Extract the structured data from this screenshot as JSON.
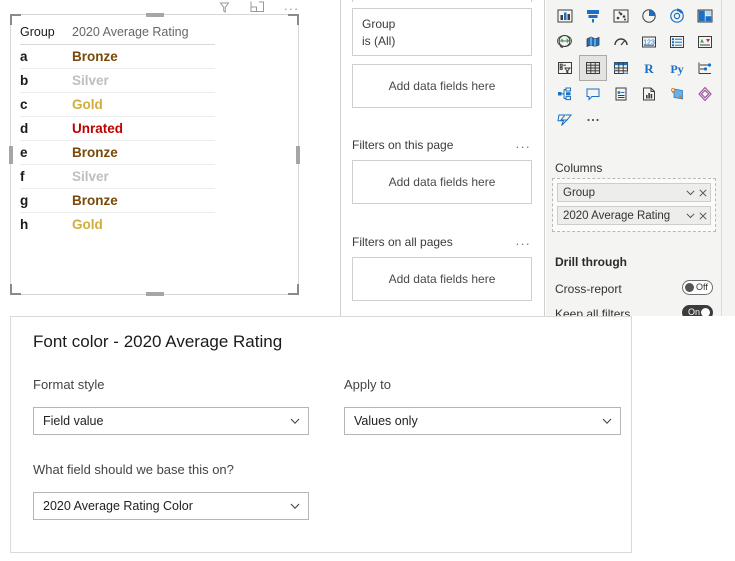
{
  "visual_header": {
    "filter_icon": "filter-icon",
    "focus_icon": "focus-mode-icon",
    "more_label": "..."
  },
  "table_visual": {
    "columns": [
      "Group",
      "2020 Average Rating"
    ],
    "rows": [
      {
        "group": "a",
        "rating": "Bronze",
        "color": "#7B4A0A"
      },
      {
        "group": "b",
        "rating": "Silver",
        "color": "#BFBFBF"
      },
      {
        "group": "c",
        "rating": "Gold",
        "color": "#CFAE3B"
      },
      {
        "group": "d",
        "rating": "Unrated",
        "color": "#C00000"
      },
      {
        "group": "e",
        "rating": "Bronze",
        "color": "#7B4A0A"
      },
      {
        "group": "f",
        "rating": "Silver",
        "color": "#BFBFBF"
      },
      {
        "group": "g",
        "rating": "Bronze",
        "color": "#7B4A0A"
      },
      {
        "group": "h",
        "rating": "Gold",
        "color": "#CFAE3B"
      }
    ]
  },
  "filters_pane": {
    "visual_filter_card": {
      "field": "Group",
      "condition": "is (All)"
    },
    "visual_dropzone": "Add data fields here",
    "page_section": {
      "title": "Filters on this page",
      "menu": "...",
      "dropzone": "Add data fields here"
    },
    "all_pages_section": {
      "title": "Filters on all pages",
      "menu": "...",
      "dropzone": "Add data fields here"
    }
  },
  "viz_pane": {
    "icons": [
      "stacked-bar-chart-icon",
      "stacked-column-chart-icon",
      "scatter-chart-icon",
      "pie-chart-icon",
      "donut-chart-icon",
      "treemap-icon",
      "globe-map-icon",
      "filled-map-icon",
      "gauge-icon",
      "card-number-icon",
      "multi-row-card-icon",
      "kpi-icon",
      "slicer-icon",
      "table-icon",
      "matrix-icon",
      "r-script-visual-icon",
      "python-visual-icon",
      "key-influencers-icon",
      "decomposition-tree-icon",
      "q-and-a-icon",
      "smart-narrative-icon",
      "paginated-report-icon",
      "arcgis-map-icon",
      "power-apps-icon",
      "power-automate-icon",
      "more-visuals-icon"
    ],
    "selected_icon": "table-icon",
    "columns_section_title": "Columns",
    "wells": [
      {
        "label": "Group",
        "chevron": "chevron-down-icon",
        "remove": "close-icon"
      },
      {
        "label": "2020 Average Rating",
        "chevron": "chevron-down-icon",
        "remove": "close-icon"
      }
    ],
    "drill_through_title": "Drill through",
    "cross_report": {
      "label": "Cross-report",
      "state": "Off"
    },
    "keep_all_filters": {
      "label": "Keep all filters",
      "state": "On"
    }
  },
  "dialog": {
    "title": "Font color - 2020 Average Rating",
    "format_style": {
      "label": "Format style",
      "value": "Field value",
      "chevron": "chevron-down-icon"
    },
    "apply_to": {
      "label": "Apply to",
      "value": "Values only",
      "chevron": "chevron-down-icon"
    },
    "base_field": {
      "label": "What field should we base this on?",
      "value": "2020 Average Rating Color",
      "chevron": "chevron-down-icon"
    }
  }
}
